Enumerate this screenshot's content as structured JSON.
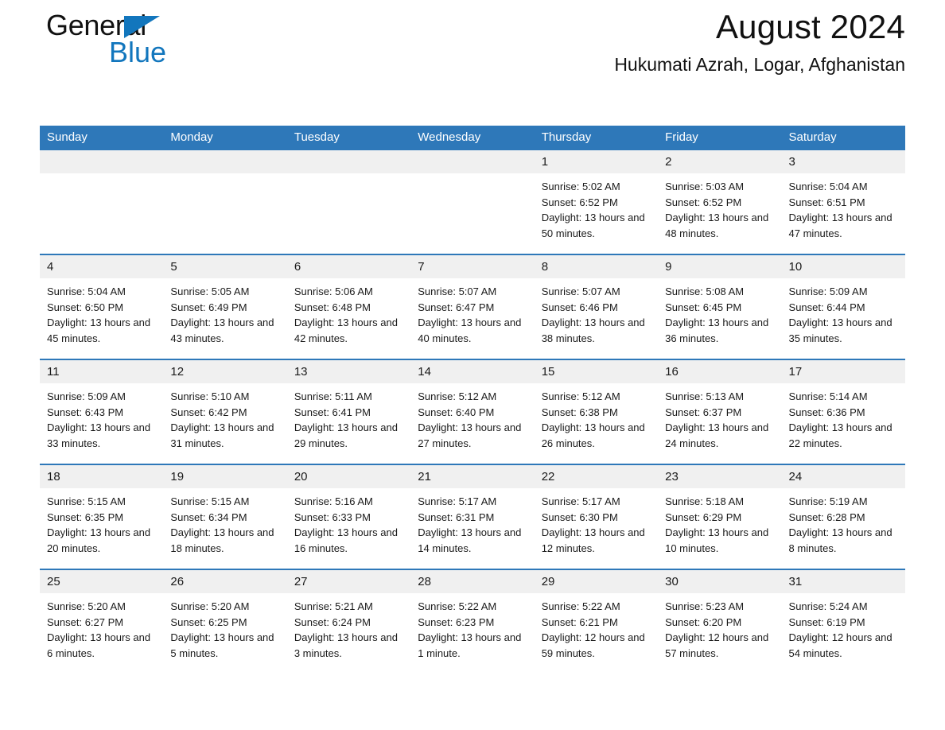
{
  "logo": {
    "word1": "General",
    "word2": "Blue",
    "triangle_color": "#1276bd"
  },
  "header": {
    "title": "August 2024",
    "subtitle": "Hukumati Azrah, Logar, Afghanistan"
  },
  "theme": {
    "header_blue": "#2e78b9",
    "daynum_gray": "#f0f0f0",
    "text": "#1a1a1a"
  },
  "weekday_headers": [
    "Sunday",
    "Monday",
    "Tuesday",
    "Wednesday",
    "Thursday",
    "Friday",
    "Saturday"
  ],
  "labels": {
    "sunrise_prefix": "Sunrise:",
    "sunset_prefix": "Sunset:",
    "daylight_prefix": "Daylight:"
  },
  "weeks": [
    [
      {
        "day": "",
        "empty": true
      },
      {
        "day": "",
        "empty": true
      },
      {
        "day": "",
        "empty": true
      },
      {
        "day": "",
        "empty": true
      },
      {
        "day": "1",
        "sunrise": "Sunrise: 5:02 AM",
        "sunset": "Sunset: 6:52 PM",
        "daylight": "Daylight: 13 hours and 50 minutes."
      },
      {
        "day": "2",
        "sunrise": "Sunrise: 5:03 AM",
        "sunset": "Sunset: 6:52 PM",
        "daylight": "Daylight: 13 hours and 48 minutes."
      },
      {
        "day": "3",
        "sunrise": "Sunrise: 5:04 AM",
        "sunset": "Sunset: 6:51 PM",
        "daylight": "Daylight: 13 hours and 47 minutes."
      }
    ],
    [
      {
        "day": "4",
        "sunrise": "Sunrise: 5:04 AM",
        "sunset": "Sunset: 6:50 PM",
        "daylight": "Daylight: 13 hours and 45 minutes."
      },
      {
        "day": "5",
        "sunrise": "Sunrise: 5:05 AM",
        "sunset": "Sunset: 6:49 PM",
        "daylight": "Daylight: 13 hours and 43 minutes."
      },
      {
        "day": "6",
        "sunrise": "Sunrise: 5:06 AM",
        "sunset": "Sunset: 6:48 PM",
        "daylight": "Daylight: 13 hours and 42 minutes."
      },
      {
        "day": "7",
        "sunrise": "Sunrise: 5:07 AM",
        "sunset": "Sunset: 6:47 PM",
        "daylight": "Daylight: 13 hours and 40 minutes."
      },
      {
        "day": "8",
        "sunrise": "Sunrise: 5:07 AM",
        "sunset": "Sunset: 6:46 PM",
        "daylight": "Daylight: 13 hours and 38 minutes."
      },
      {
        "day": "9",
        "sunrise": "Sunrise: 5:08 AM",
        "sunset": "Sunset: 6:45 PM",
        "daylight": "Daylight: 13 hours and 36 minutes."
      },
      {
        "day": "10",
        "sunrise": "Sunrise: 5:09 AM",
        "sunset": "Sunset: 6:44 PM",
        "daylight": "Daylight: 13 hours and 35 minutes."
      }
    ],
    [
      {
        "day": "11",
        "sunrise": "Sunrise: 5:09 AM",
        "sunset": "Sunset: 6:43 PM",
        "daylight": "Daylight: 13 hours and 33 minutes."
      },
      {
        "day": "12",
        "sunrise": "Sunrise: 5:10 AM",
        "sunset": "Sunset: 6:42 PM",
        "daylight": "Daylight: 13 hours and 31 minutes."
      },
      {
        "day": "13",
        "sunrise": "Sunrise: 5:11 AM",
        "sunset": "Sunset: 6:41 PM",
        "daylight": "Daylight: 13 hours and 29 minutes."
      },
      {
        "day": "14",
        "sunrise": "Sunrise: 5:12 AM",
        "sunset": "Sunset: 6:40 PM",
        "daylight": "Daylight: 13 hours and 27 minutes."
      },
      {
        "day": "15",
        "sunrise": "Sunrise: 5:12 AM",
        "sunset": "Sunset: 6:38 PM",
        "daylight": "Daylight: 13 hours and 26 minutes."
      },
      {
        "day": "16",
        "sunrise": "Sunrise: 5:13 AM",
        "sunset": "Sunset: 6:37 PM",
        "daylight": "Daylight: 13 hours and 24 minutes."
      },
      {
        "day": "17",
        "sunrise": "Sunrise: 5:14 AM",
        "sunset": "Sunset: 6:36 PM",
        "daylight": "Daylight: 13 hours and 22 minutes."
      }
    ],
    [
      {
        "day": "18",
        "sunrise": "Sunrise: 5:15 AM",
        "sunset": "Sunset: 6:35 PM",
        "daylight": "Daylight: 13 hours and 20 minutes."
      },
      {
        "day": "19",
        "sunrise": "Sunrise: 5:15 AM",
        "sunset": "Sunset: 6:34 PM",
        "daylight": "Daylight: 13 hours and 18 minutes."
      },
      {
        "day": "20",
        "sunrise": "Sunrise: 5:16 AM",
        "sunset": "Sunset: 6:33 PM",
        "daylight": "Daylight: 13 hours and 16 minutes."
      },
      {
        "day": "21",
        "sunrise": "Sunrise: 5:17 AM",
        "sunset": "Sunset: 6:31 PM",
        "daylight": "Daylight: 13 hours and 14 minutes."
      },
      {
        "day": "22",
        "sunrise": "Sunrise: 5:17 AM",
        "sunset": "Sunset: 6:30 PM",
        "daylight": "Daylight: 13 hours and 12 minutes."
      },
      {
        "day": "23",
        "sunrise": "Sunrise: 5:18 AM",
        "sunset": "Sunset: 6:29 PM",
        "daylight": "Daylight: 13 hours and 10 minutes."
      },
      {
        "day": "24",
        "sunrise": "Sunrise: 5:19 AM",
        "sunset": "Sunset: 6:28 PM",
        "daylight": "Daylight: 13 hours and 8 minutes."
      }
    ],
    [
      {
        "day": "25",
        "sunrise": "Sunrise: 5:20 AM",
        "sunset": "Sunset: 6:27 PM",
        "daylight": "Daylight: 13 hours and 6 minutes."
      },
      {
        "day": "26",
        "sunrise": "Sunrise: 5:20 AM",
        "sunset": "Sunset: 6:25 PM",
        "daylight": "Daylight: 13 hours and 5 minutes."
      },
      {
        "day": "27",
        "sunrise": "Sunrise: 5:21 AM",
        "sunset": "Sunset: 6:24 PM",
        "daylight": "Daylight: 13 hours and 3 minutes."
      },
      {
        "day": "28",
        "sunrise": "Sunrise: 5:22 AM",
        "sunset": "Sunset: 6:23 PM",
        "daylight": "Daylight: 13 hours and 1 minute."
      },
      {
        "day": "29",
        "sunrise": "Sunrise: 5:22 AM",
        "sunset": "Sunset: 6:21 PM",
        "daylight": "Daylight: 12 hours and 59 minutes."
      },
      {
        "day": "30",
        "sunrise": "Sunrise: 5:23 AM",
        "sunset": "Sunset: 6:20 PM",
        "daylight": "Daylight: 12 hours and 57 minutes."
      },
      {
        "day": "31",
        "sunrise": "Sunrise: 5:24 AM",
        "sunset": "Sunset: 6:19 PM",
        "daylight": "Daylight: 12 hours and 54 minutes."
      }
    ]
  ]
}
